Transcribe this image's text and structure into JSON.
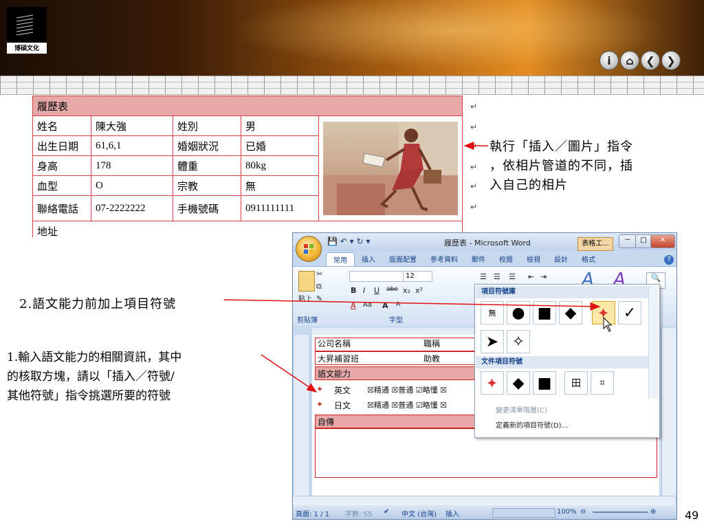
{
  "slide": {
    "logo_text": "博碩文化",
    "page_number": "49",
    "nav_buttons": [
      "info",
      "home",
      "back",
      "forward"
    ],
    "nav_glyphs": [
      "i",
      "⌂",
      "❮",
      "❯"
    ]
  },
  "resume": {
    "title": "履歷表",
    "rows": [
      [
        "姓名",
        "陳大強",
        "姓別",
        "男"
      ],
      [
        "出生日期",
        "61,6,1",
        "婚姻狀況",
        "已婚"
      ],
      [
        "身高",
        "178",
        "體重",
        "80kg"
      ],
      [
        "血型",
        "O",
        "宗教",
        "無"
      ],
      [
        "聯絡電話",
        "07-2222222",
        "手機號碼",
        "0911111111"
      ]
    ],
    "next_row_label": "地址",
    "pilcrow": "↵"
  },
  "annotations": {
    "photo_note": "執行「插入／圖片」指令，依相片管道的不同，插入自己的相片",
    "photo_note_lines": [
      "執行「插入／圖片」指令",
      "，依相片管道的不同，插",
      "入自己的相片"
    ],
    "bullet_note": "2.語文能力前加上項目符號",
    "symbol_note_lines": [
      "1.輸入語文能力的相關資訊，其中",
      "的核取方塊，請以「插入／符號/",
      "其他符號」指令挑選所要的符號"
    ]
  },
  "word": {
    "title": "履歷表 - Microsoft Word",
    "table_tools": "表格工...",
    "window_controls": [
      "－",
      "□",
      "✕"
    ],
    "quick_access": "💾 ↶ ▾ ↻ ▾",
    "tabs": [
      "常用",
      "插入",
      "版面配置",
      "參考資料",
      "郵件",
      "校閱",
      "檢視",
      "設計",
      "格式"
    ],
    "active_tab": "常用",
    "help": "?",
    "ribbon": {
      "clipboard_group": "剪貼簿",
      "paste_label": "貼上",
      "font_group": "字型",
      "font_size": "12",
      "font_buttons": [
        "B",
        "I",
        "U",
        "abe",
        "x₂",
        "x²"
      ],
      "font_buttons2": [
        "A",
        "Aa",
        "A",
        "A"
      ],
      "paragraph_buttons": [
        "☰",
        "☰",
        "☰",
        "⇤",
        "⇥"
      ],
      "style_glyphs": [
        "A",
        "A"
      ],
      "find_glyph": "🔍"
    },
    "document_rows": [
      {
        "label": "公司名稱",
        "value": "職稱"
      },
      {
        "label": "大昇補習班",
        "value": "助教"
      },
      {
        "label": "語文能力",
        "value": ""
      },
      {
        "label": "英文",
        "value": "☒精通 ☒普通 ☑略懂 ☒"
      },
      {
        "label": "日文",
        "value": "☒精通 ☒普通 ☑略懂 ☒"
      },
      {
        "label": "自傳",
        "value": ""
      }
    ],
    "status": {
      "page": "頁面: 1 / 1",
      "words": "字數: 55",
      "language": "中文 (台灣)",
      "mode": "插入",
      "zoom": "100%"
    }
  },
  "bullet_gallery": {
    "library_header": "項目符號庫",
    "none_label": "無",
    "library_symbols": [
      "●",
      "■",
      "◆",
      "⯌",
      "✓",
      "➤",
      "✧"
    ],
    "document_header": "文件項目符號",
    "document_symbols": [
      "⯌",
      "◆",
      "■",
      "田",
      "⌗"
    ],
    "change_level": "變更清單階層(C)",
    "define_new": "定義新的項目符號(D)..."
  },
  "colors": {
    "table_border": "#d64040",
    "table_header": "#e7a8a8",
    "arrow": "#e01010",
    "ribbon_text": "#15428b"
  }
}
